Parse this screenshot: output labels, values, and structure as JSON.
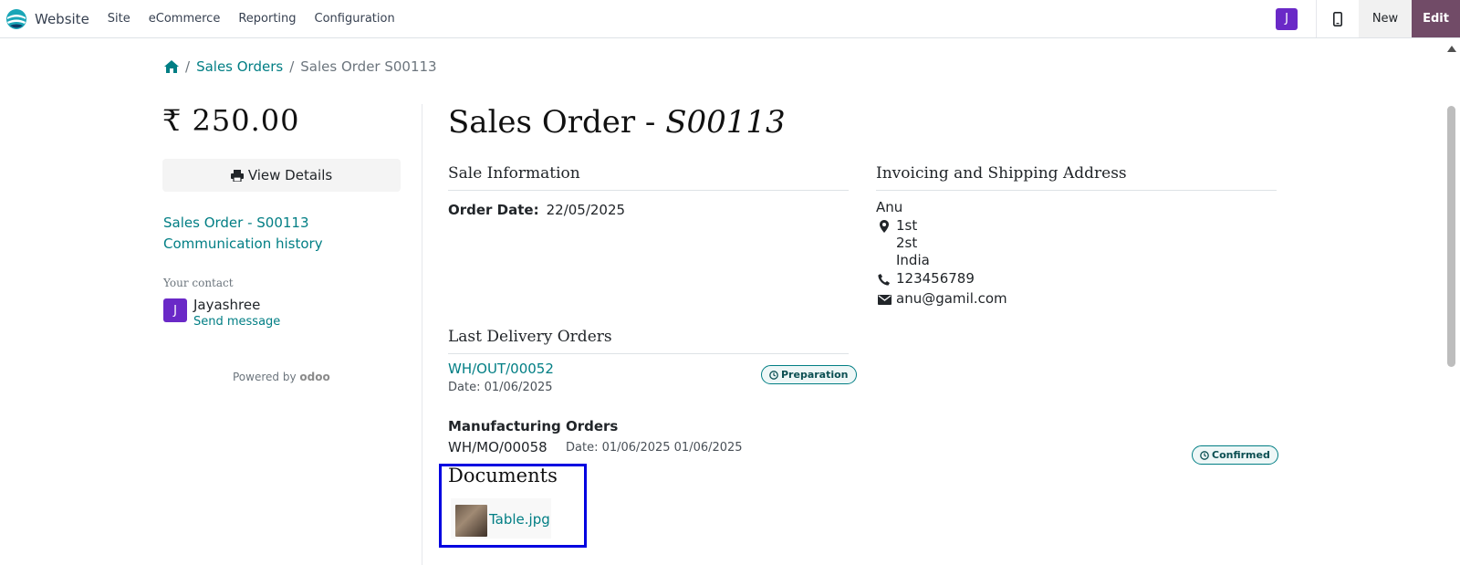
{
  "navbar": {
    "brand": "Website",
    "menu": [
      "Site",
      "eCommerce",
      "Reporting",
      "Configuration"
    ],
    "user_initial": "J",
    "new_label": "New",
    "edit_label": "Edit"
  },
  "breadcrumb": {
    "items": [
      "Sales Orders",
      "Sales Order S00113"
    ]
  },
  "sidebar": {
    "amount": "₹ 250.00",
    "view_details": "View Details",
    "links": [
      "Sales Order - S00113",
      "Communication history"
    ],
    "contact_label": "Your contact",
    "contact_initial": "J",
    "contact_name": "Jayashree",
    "send_message": "Send message",
    "powered_by": "Powered by",
    "powered_brand": "odoo"
  },
  "main": {
    "title_prefix": "Sales Order - ",
    "order_number": "S00113",
    "sale_info": {
      "title": "Sale Information",
      "order_date_label": "Order Date:",
      "order_date": "22/05/2025"
    },
    "address": {
      "title": "Invoicing and Shipping Address",
      "name": "Anu",
      "line1": "1st",
      "line2": "2st",
      "country": "India",
      "phone": "123456789",
      "email": "anu@gamil.com"
    },
    "delivery": {
      "title": "Last Delivery Orders",
      "ref": "WH/OUT/00052",
      "date_label": "Date:",
      "date": "01/06/2025",
      "status": "Preparation"
    },
    "manufacturing": {
      "title": "Manufacturing Orders",
      "ref": "WH/MO/00058",
      "date_label": "Date:",
      "date": "01/06/2025 01/06/2025",
      "status": "Confirmed"
    },
    "documents": {
      "title": "Documents",
      "file_name": "Table.jpg"
    }
  },
  "colors": {
    "link": "#017e84",
    "edit_button": "#714b67",
    "avatar": "#6a29c7",
    "highlight_box": "#0000e0"
  }
}
